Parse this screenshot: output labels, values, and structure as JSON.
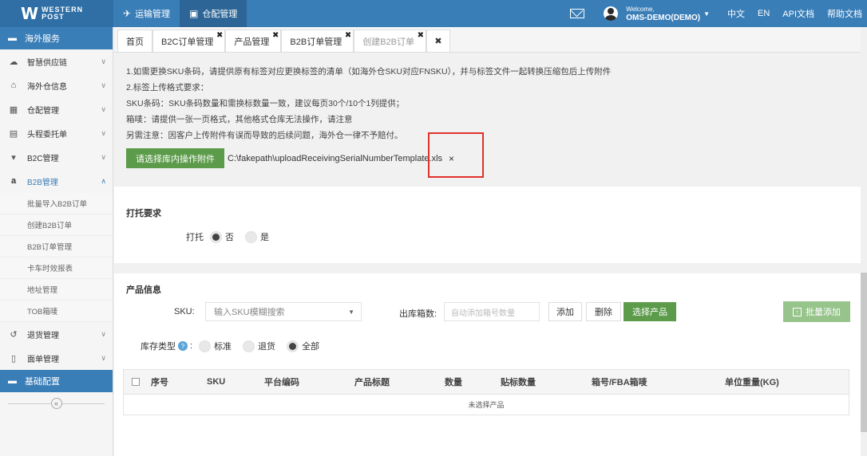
{
  "brand": {
    "mark": "W",
    "line1": "WESTERN",
    "line2": "POST"
  },
  "topnav": [
    {
      "label": "运输管理",
      "icon": "plane-icon"
    },
    {
      "label": "仓配管理",
      "icon": "warehouse-icon"
    }
  ],
  "user": {
    "welcome": "Welcome,",
    "name": "OMS-DEMO(DEMO)"
  },
  "top_links": {
    "zh": "中文",
    "en": "EN",
    "api": "API文档",
    "help": "帮助文档"
  },
  "sidebar": {
    "header": "海外服务",
    "items": [
      {
        "label": "智慧供应链",
        "icon": "cloud-icon"
      },
      {
        "label": "海外仓信息",
        "icon": "home-icon"
      },
      {
        "label": "仓配管理",
        "icon": "grid-icon"
      },
      {
        "label": "头程委托单",
        "icon": "briefcase-icon"
      },
      {
        "label": "B2C管理",
        "icon": "cart-icon"
      },
      {
        "label": "B2B管理",
        "icon": "amazon-icon"
      }
    ],
    "sub_items": [
      "批量导入B2B订单",
      "创建B2B订单",
      "B2B订单管理",
      "卡车时效报表",
      "地址管理",
      "TOB箱唛"
    ],
    "items2": [
      {
        "label": "退货管理",
        "icon": "return-icon"
      },
      {
        "label": "面单管理",
        "icon": "document-icon"
      }
    ],
    "footer_head": "基础配置",
    "collapse": "«"
  },
  "tabs": [
    {
      "label": "首页",
      "closable": false
    },
    {
      "label": "B2C订单管理",
      "closable": true
    },
    {
      "label": "产品管理",
      "closable": true
    },
    {
      "label": "B2B订单管理",
      "closable": true
    },
    {
      "label": "创建B2B订单",
      "closable": true
    }
  ],
  "tab_close_all": "✖",
  "notice": {
    "lines": [
      "1.如需更换SKU条码，请提供原有标签对应更换标签的清单（如海外仓SKU对应FNSKU），并与标签文件一起转换压缩包后上传附件",
      "2.标签上传格式要求：",
      "SKU条码：SKU条码数量和需换标数量一致，建议每页30个/10个1列提供；",
      "箱唛：请提供一张一页格式，其他格式仓库无法操作，请注意",
      "另需注意：因客户上传附件有误而导致的后续问题，海外仓一律不予赔付。"
    ],
    "upload_button": "请选择库内操作附件",
    "file_name": "C:\\fakepath\\uploadReceivingSerialNumberTemplate.xls",
    "file_remove": "×"
  },
  "pallet": {
    "title": "打托要求",
    "label": "打托",
    "options": [
      {
        "label": "否",
        "checked": true
      },
      {
        "label": "是",
        "checked": false
      }
    ]
  },
  "product": {
    "title": "产品信息",
    "sku_label": "SKU:",
    "sku_placeholder": "输入SKU模糊搜索",
    "boxes_label": "出库箱数:",
    "boxes_placeholder": "自动添加箱号数量",
    "add_button": "添加",
    "delete_button": "删除",
    "select_button": "选择产品",
    "bulk_add_button": "批量添加",
    "stock_type_label": "库存类型",
    "stock_options": [
      {
        "label": "标准",
        "checked": false
      },
      {
        "label": "退货",
        "checked": false
      },
      {
        "label": "全部",
        "checked": true
      }
    ],
    "columns": [
      "序号",
      "SKU",
      "平台编码",
      "产品标题",
      "数量",
      "贴标数量",
      "箱号/FBA箱唛",
      "单位重量(KG)"
    ],
    "empty_text": "未选择产品"
  },
  "colors": {
    "primary": "#3a7eb8",
    "green": "#5b9b4a",
    "highlight": "#e0312b"
  }
}
